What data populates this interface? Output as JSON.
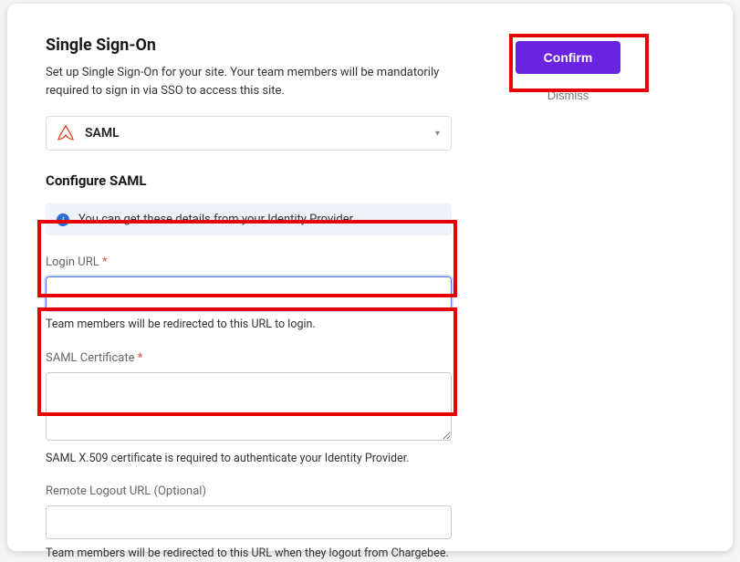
{
  "header": {
    "title": "Single Sign-On",
    "description": "Set up Single Sign-On for your site. Your team members will be mandatorily required to sign in via SSO to access this site."
  },
  "provider_select": {
    "selected": "SAML",
    "icon_name": "saml-icon"
  },
  "section_title": "Configure SAML",
  "info_banner": "You can get these details from your Identity Provider.",
  "fields": {
    "login_url": {
      "label": "Login URL",
      "required_mark": "*",
      "value": "",
      "helper": "Team members will be redirected to this URL to login."
    },
    "saml_cert": {
      "label": "SAML Certificate",
      "required_mark": "*",
      "value": "",
      "helper": "SAML X.509 certificate is required to authenticate your Identity Provider."
    },
    "logout_url": {
      "label": "Remote Logout URL (Optional)",
      "value": "",
      "helper": "Team members will be redirected to this URL when they logout from Chargebee."
    }
  },
  "actions": {
    "confirm": "Confirm",
    "dismiss": "Dismiss"
  }
}
